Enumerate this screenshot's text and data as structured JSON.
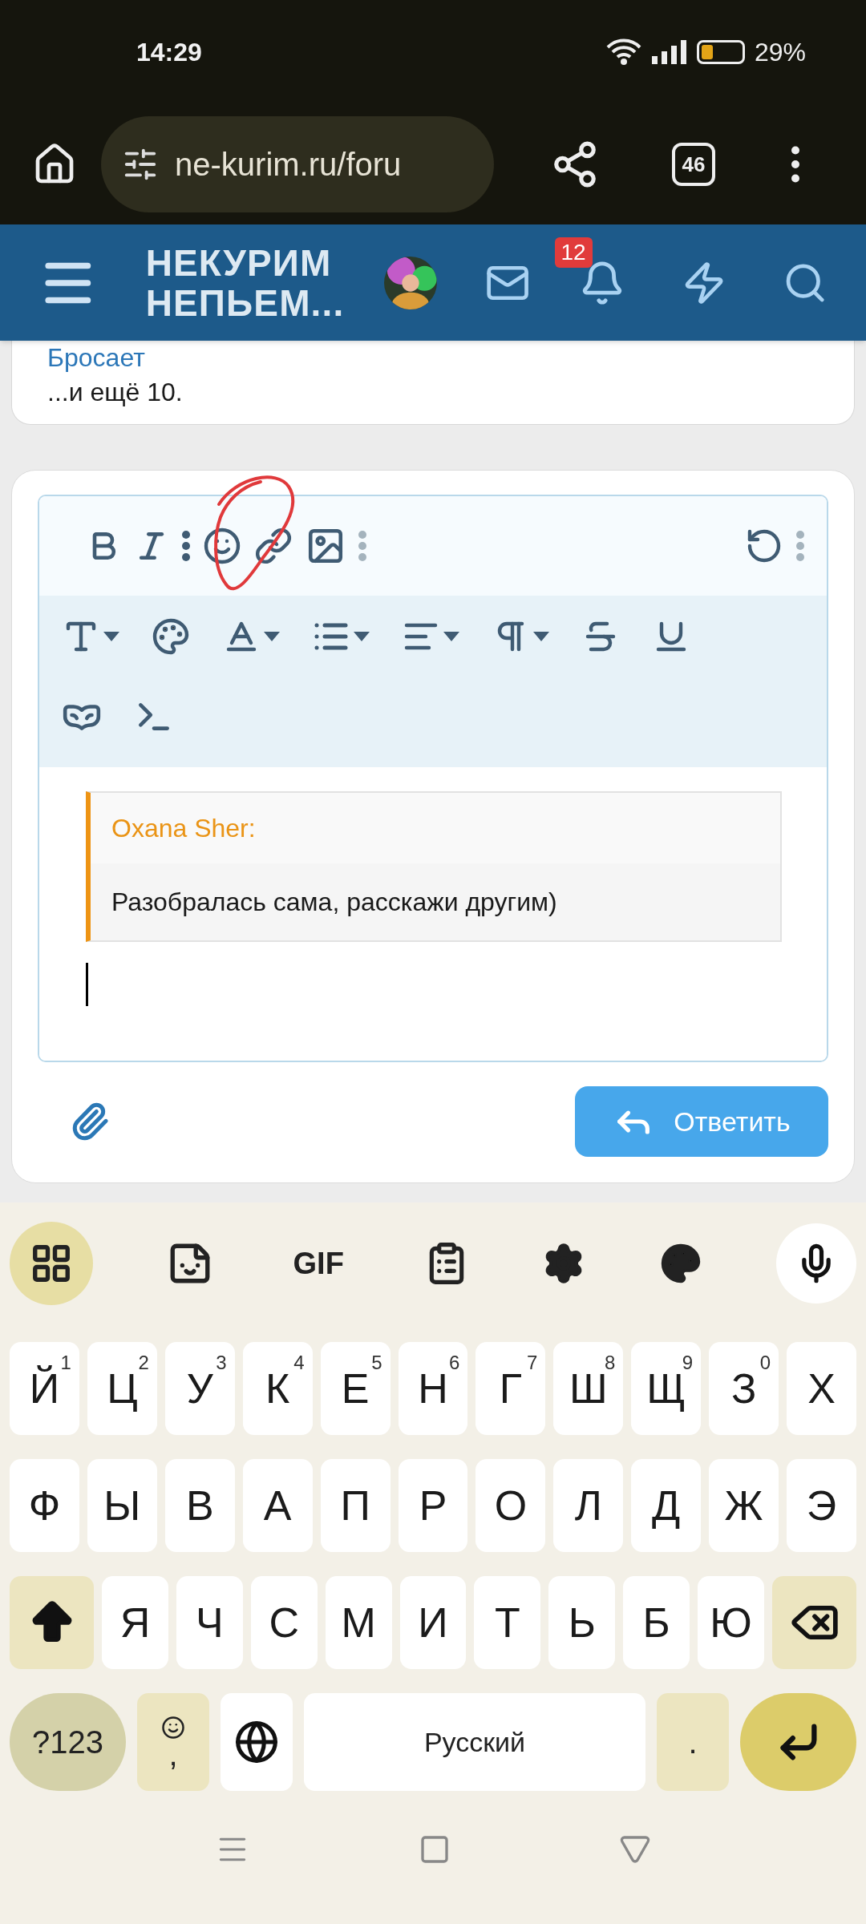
{
  "status_bar": {
    "time": "14:29",
    "battery": "29%"
  },
  "browser": {
    "url": "ne-kurim.ru/foru",
    "tab_count": "46"
  },
  "forum_header": {
    "logo_lines": [
      "НЕКУРИМ",
      "НЕПЬЕМ..."
    ],
    "notification_count": "12"
  },
  "previous_post": {
    "link": "Бросает",
    "more": "...и ещё 10."
  },
  "editor": {
    "quote": {
      "author": "Oxana Sher:",
      "text": "Разобралась сама, расскажи другим)"
    },
    "reply_button": "Ответить"
  },
  "keyboard": {
    "tools": {
      "gif": "GIF"
    },
    "rows": [
      [
        {
          "label": "Й",
          "hint": "1"
        },
        {
          "label": "Ц",
          "hint": "2"
        },
        {
          "label": "У",
          "hint": "3"
        },
        {
          "label": "К",
          "hint": "4"
        },
        {
          "label": "Е",
          "hint": "5"
        },
        {
          "label": "Н",
          "hint": "6"
        },
        {
          "label": "Г",
          "hint": "7"
        },
        {
          "label": "Ш",
          "hint": "8"
        },
        {
          "label": "Щ",
          "hint": "9"
        },
        {
          "label": "З",
          "hint": "0"
        },
        {
          "label": "Х"
        }
      ],
      [
        {
          "label": "Ф"
        },
        {
          "label": "Ы"
        },
        {
          "label": "В"
        },
        {
          "label": "А"
        },
        {
          "label": "П"
        },
        {
          "label": "Р"
        },
        {
          "label": "О"
        },
        {
          "label": "Л"
        },
        {
          "label": "Д"
        },
        {
          "label": "Ж"
        },
        {
          "label": "Э"
        }
      ],
      [
        {
          "kind": "shift"
        },
        {
          "label": "Я"
        },
        {
          "label": "Ч"
        },
        {
          "label": "С"
        },
        {
          "label": "М"
        },
        {
          "label": "И"
        },
        {
          "label": "Т"
        },
        {
          "label": "Ь"
        },
        {
          "label": "Б"
        },
        {
          "label": "Ю"
        },
        {
          "kind": "backspace"
        }
      ]
    ],
    "symbols_key": "?123",
    "comma_key": ",",
    "space_key": "Русский",
    "period_key": "."
  }
}
